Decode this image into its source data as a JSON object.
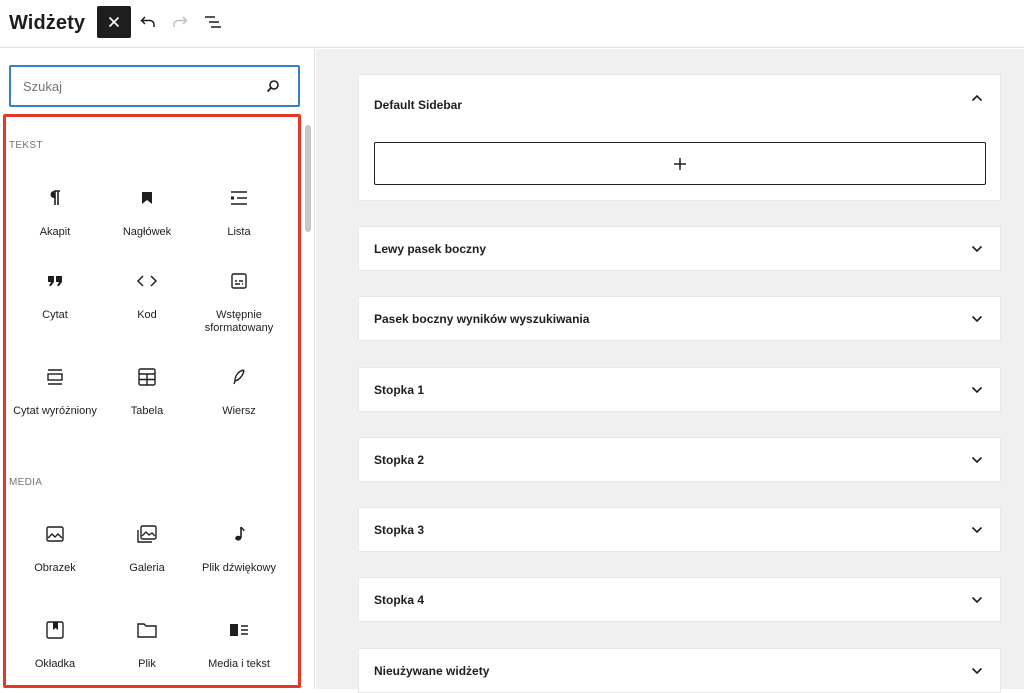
{
  "app": {
    "title": "Widżety"
  },
  "toolbar": {
    "close": "close-icon",
    "undo": "undo-icon",
    "redo": "redo-icon",
    "list_view": "list-view-icon"
  },
  "search": {
    "placeholder": "Szukaj",
    "value": ""
  },
  "categories": [
    {
      "label": "TEKST",
      "blocks": [
        {
          "label": "Akapit",
          "icon": "paragraph-icon"
        },
        {
          "label": "Nagłówek",
          "icon": "heading-icon"
        },
        {
          "label": "Lista",
          "icon": "list-icon"
        },
        {
          "label": "Cytat",
          "icon": "quote-icon"
        },
        {
          "label": "Kod",
          "icon": "code-icon"
        },
        {
          "label": "Wstępnie sformatowany",
          "icon": "preformatted-icon"
        },
        {
          "label": "Cytat wyróżniony",
          "icon": "pullquote-icon"
        },
        {
          "label": "Tabela",
          "icon": "table-icon"
        },
        {
          "label": "Wiersz",
          "icon": "verse-icon"
        }
      ]
    },
    {
      "label": "MEDIA",
      "blocks": [
        {
          "label": "Obrazek",
          "icon": "image-icon"
        },
        {
          "label": "Galeria",
          "icon": "gallery-icon"
        },
        {
          "label": "Plik dźwiękowy",
          "icon": "audio-icon"
        },
        {
          "label": "Okładka",
          "icon": "cover-icon"
        },
        {
          "label": "Plik",
          "icon": "file-icon"
        },
        {
          "label": "Media i tekst",
          "icon": "media-text-icon"
        }
      ]
    }
  ],
  "widget_areas": [
    {
      "title": "Default Sidebar",
      "expanded": true
    },
    {
      "title": "Lewy pasek boczny",
      "expanded": false
    },
    {
      "title": "Pasek boczny wyników wyszukiwania",
      "expanded": false
    },
    {
      "title": "Stopka 1",
      "expanded": false
    },
    {
      "title": "Stopka 2",
      "expanded": false
    },
    {
      "title": "Stopka 3",
      "expanded": false
    },
    {
      "title": "Stopka 4",
      "expanded": false
    },
    {
      "title": "Nieużywane widżety",
      "expanded": false
    }
  ],
  "colors": {
    "accent": "#3582c4",
    "highlight": "#e43a25",
    "dark": "#1e1e1e",
    "canvas": "#f0f0f0"
  }
}
